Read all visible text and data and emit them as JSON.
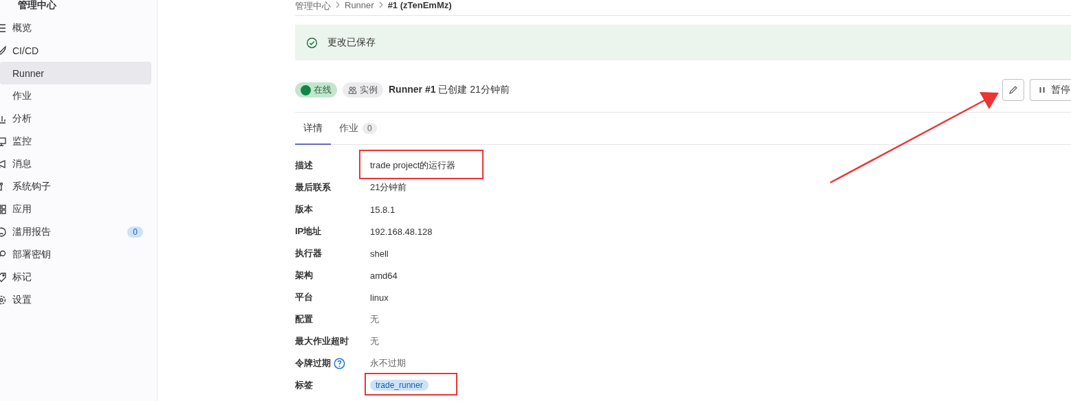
{
  "sidebar": {
    "title": "管理中心",
    "items": [
      {
        "label": "概览",
        "selected": false
      },
      {
        "label": "CI/CD",
        "selected": false,
        "children": [
          {
            "label": "Runner",
            "selected": true
          },
          {
            "label": "作业",
            "selected": false
          }
        ]
      },
      {
        "label": "分析",
        "selected": false
      },
      {
        "label": "监控",
        "selected": false
      },
      {
        "label": "消息",
        "selected": false
      },
      {
        "label": "系统钩子",
        "selected": false
      },
      {
        "label": "应用",
        "selected": false
      },
      {
        "label": "滥用报告",
        "selected": false,
        "badge": "0"
      },
      {
        "label": "部署密钥",
        "selected": false
      },
      {
        "label": "标记",
        "selected": false
      },
      {
        "label": "设置",
        "selected": false
      }
    ]
  },
  "breadcrumb": [
    "管理中心",
    "Runner",
    "#1 (zTenEmMz)"
  ],
  "alert": {
    "message": "更改已保存"
  },
  "header": {
    "status": "在线",
    "type": "实例",
    "title": "Runner #1",
    "created": "已创建 21分钟前",
    "pause_button": "暂停"
  },
  "tabs": [
    {
      "label": "详情",
      "selected": true
    },
    {
      "label": "作业",
      "selected": false,
      "count": "0"
    }
  ],
  "details": [
    {
      "label": "描述",
      "value": "trade project的运行器",
      "highlighted": true
    },
    {
      "label": "最后联系",
      "value": "21分钟前",
      "highlighted": false
    },
    {
      "label": "版本",
      "value": "15.8.1",
      "highlighted": false
    },
    {
      "label": "IP地址",
      "value": "192.168.48.128",
      "highlighted": false
    },
    {
      "label": "执行器",
      "value": "shell",
      "highlighted": false
    },
    {
      "label": "架构",
      "value": "amd64",
      "highlighted": false
    },
    {
      "label": "平台",
      "value": "linux",
      "highlighted": false
    },
    {
      "label": "配置",
      "value": "无",
      "highlighted": false,
      "muted": true
    },
    {
      "label": "最大作业超时",
      "value": "无",
      "highlighted": false,
      "muted": true
    },
    {
      "label": "令牌过期",
      "value": "永不过期",
      "highlighted": false,
      "muted": true,
      "help": true
    },
    {
      "label": "标签",
      "kind": "tags",
      "tags": [
        "trade_runner"
      ],
      "highlighted": true
    }
  ]
}
